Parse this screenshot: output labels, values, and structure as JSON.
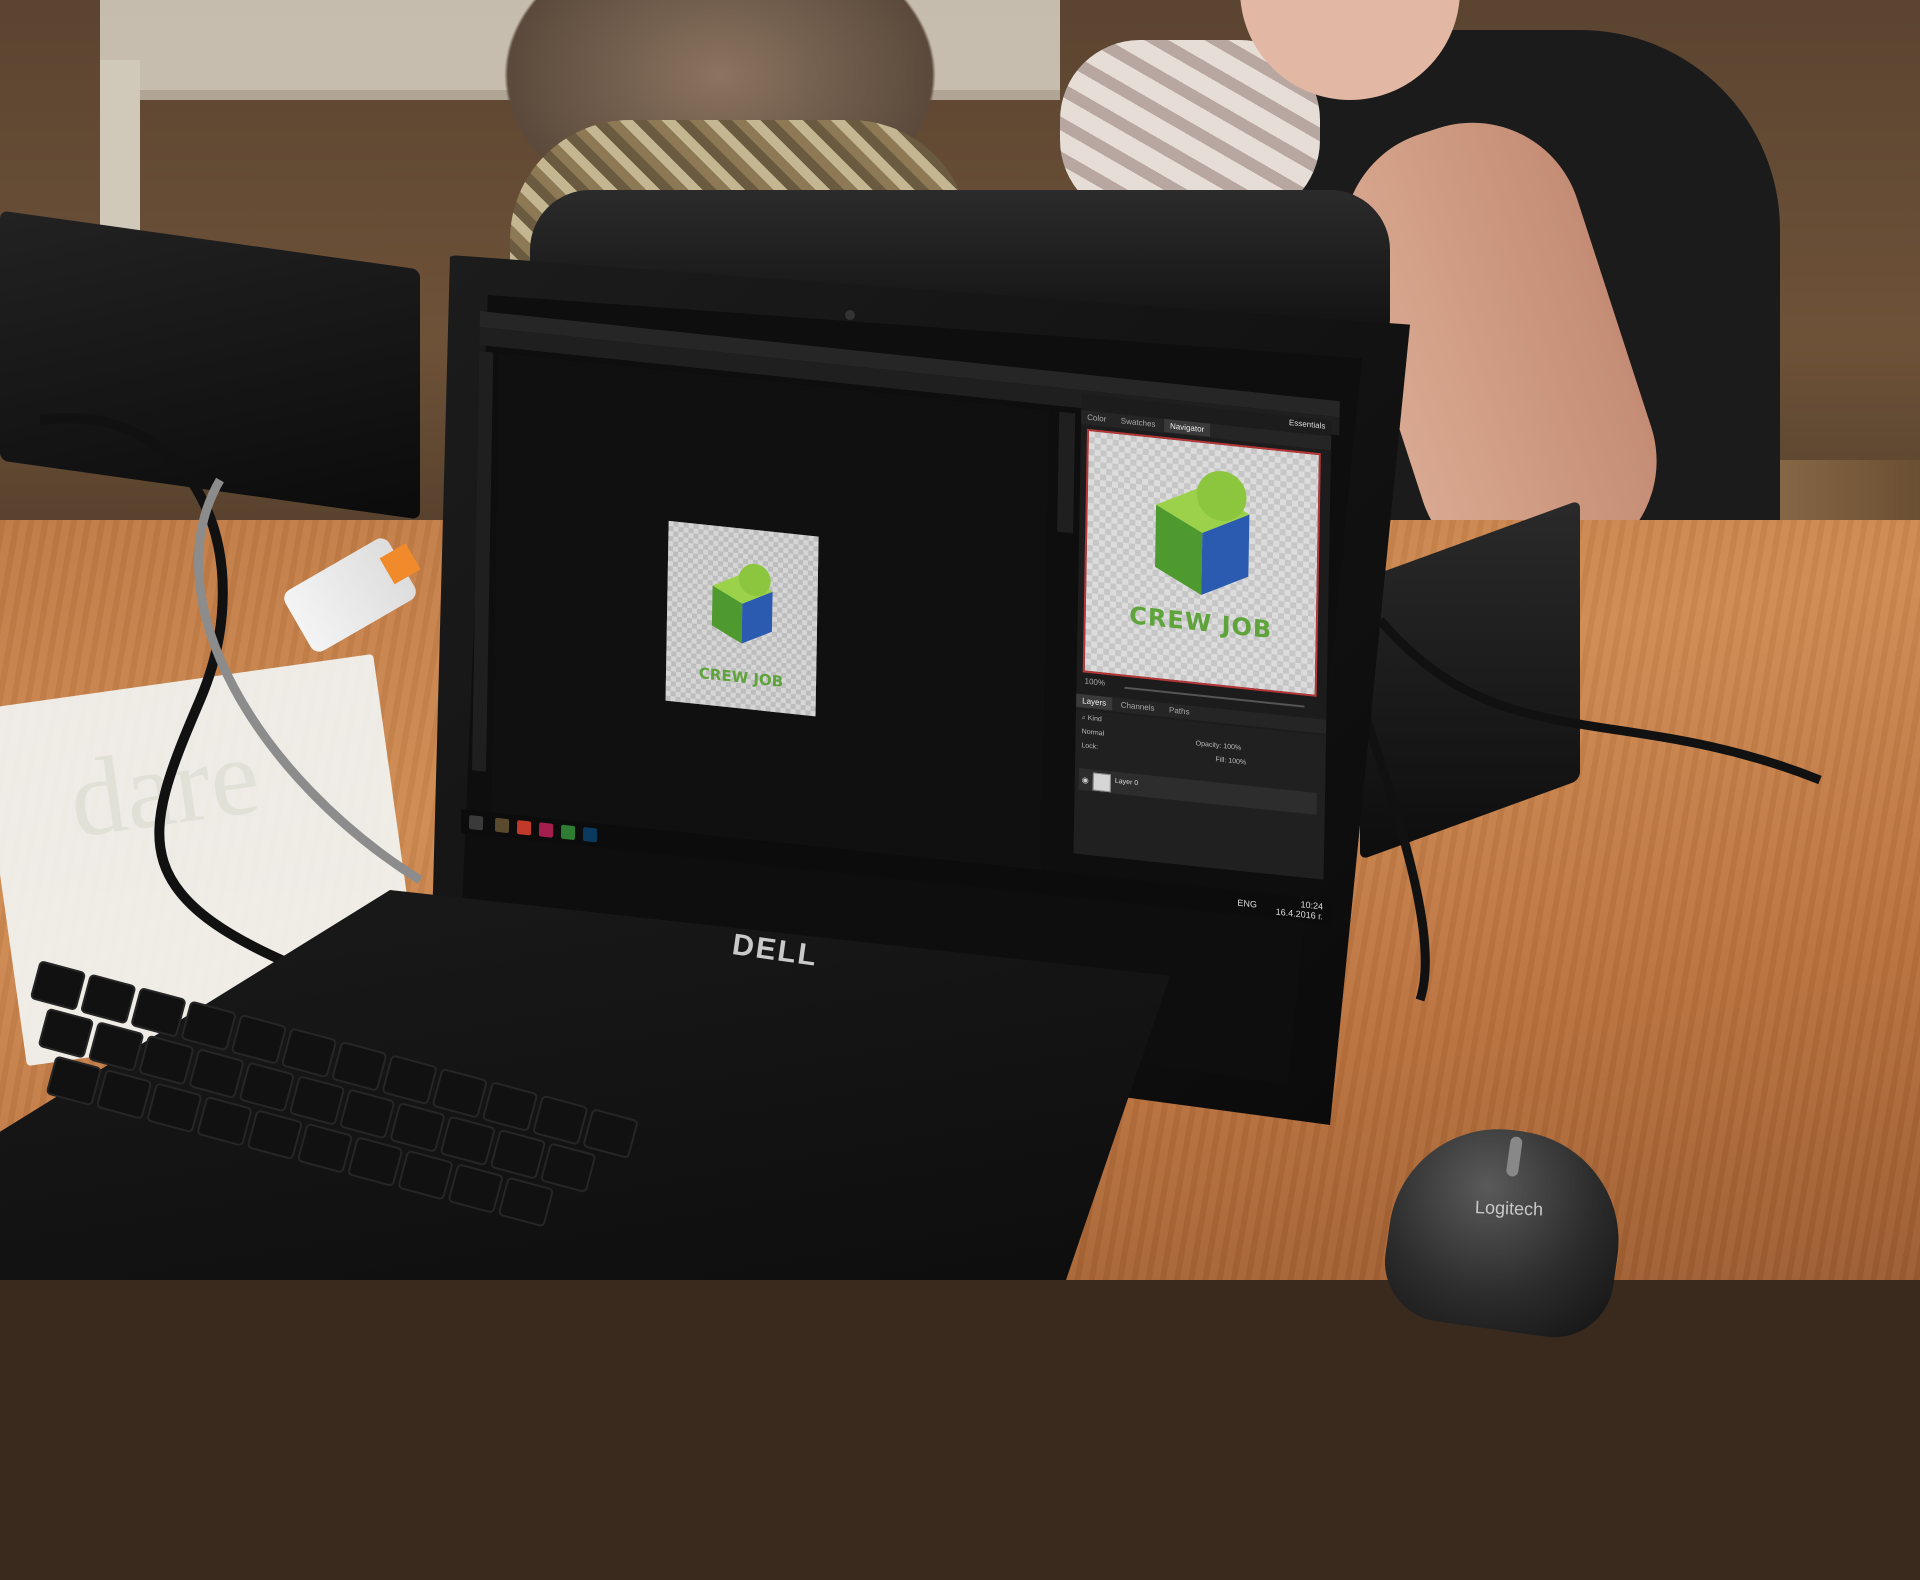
{
  "editor": {
    "tabs_top": [
      "Color",
      "Swatches",
      "Navigator"
    ],
    "active_tab": "Navigator",
    "workspace": "Essentials",
    "zoom": "100%",
    "layer_tabs": [
      "Layers",
      "Channels",
      "Paths"
    ],
    "kind_filter": "Kind",
    "blend_mode": "Normal",
    "opacity_label": "Opacity:",
    "opacity_value": "100%",
    "lock_label": "Lock:",
    "fill_label": "Fill:",
    "fill_value": "100%",
    "layer_name": "Layer 0"
  },
  "artwork": {
    "logo_text": "CREW JOB",
    "colors": {
      "green_light": "#9bd24a",
      "green_dark": "#3f8f2c",
      "blue": "#2a5bb0",
      "text_green": "#5ea43a"
    }
  },
  "taskbar": {
    "language": "ENG",
    "time": "10:24",
    "date": "16.4.2016 г."
  },
  "hardware": {
    "laptop_brand": "DELL",
    "mouse_brand": "Logitech"
  }
}
